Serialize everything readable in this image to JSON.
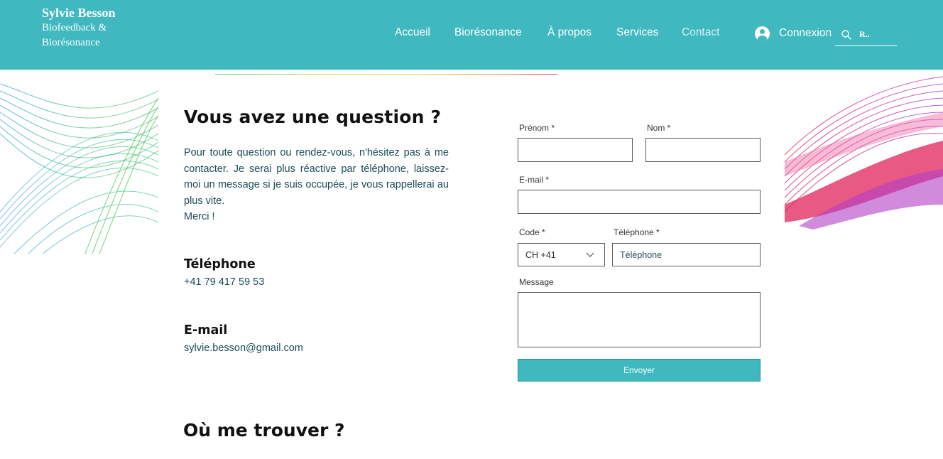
{
  "brand": {
    "name": "Sylvie Besson",
    "subtitle": "Biofeedback & Biorésonance"
  },
  "nav": {
    "items": [
      {
        "label": "Accueil"
      },
      {
        "label": "Biorésonance"
      },
      {
        "label": "À propos"
      },
      {
        "label": "Services"
      },
      {
        "label": "Contact"
      }
    ],
    "login_label": "Connexion",
    "search_value": "R..",
    "active_item": "Contact"
  },
  "contact": {
    "title": "Vous avez une question ?",
    "intro": "Pour toute question ou rendez-vous, n'hésitez pas à me contacter. Je serai plus réactive par téléphone, laissez-moi un message si je suis occupée, je vous rappellerai au plus vite.",
    "thanks": "Merci !",
    "phone_heading": "Téléphone",
    "phone_value": "+41 79 417 59 53",
    "email_heading": "E-mail",
    "email_value": "sylvie.besson@gmail.com"
  },
  "form": {
    "first_name_label": "Prénom *",
    "last_name_label": "Nom *",
    "email_label": "E-mail *",
    "code_label": "Code *",
    "code_value": "CH +41",
    "phone_label": "Téléphone *",
    "phone_placeholder": "Téléphone",
    "message_label": "Message",
    "submit_label": "Envoyer"
  },
  "location": {
    "title": "Où me trouver ?"
  },
  "colors": {
    "primary": "#3fb8bf",
    "text_body": "#1b4a5a",
    "white": "#ffffff"
  }
}
